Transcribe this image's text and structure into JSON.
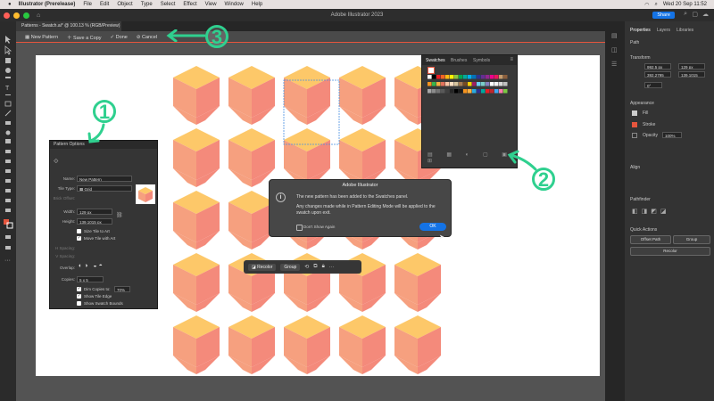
{
  "menubar": {
    "app": "Illustrator (Prerelease)",
    "items": [
      "File",
      "Edit",
      "Object",
      "Type",
      "Select",
      "Effect",
      "View",
      "Window",
      "Help"
    ],
    "datetime": "Wed 20 Sep  11:52"
  },
  "window": {
    "title": "Adobe Illustrator 2023",
    "share_label": "Share"
  },
  "document": {
    "tab_label": "Patterns - Swatch.ai* @ 100.13 % (RGB/Preview)"
  },
  "pattern_bar": {
    "new_pattern": "New Pattern",
    "save_copy": "Save a Copy",
    "done": "Done",
    "cancel": "Cancel"
  },
  "pattern_options": {
    "title": "Pattern Options",
    "name_label": "Name:",
    "name_value": "New Pattern",
    "tile_type_label": "Tile Type:",
    "tile_type_value": "Grid",
    "brick_offset_label": "Brick Offset:",
    "width_label": "Width:",
    "width_value": "129 px",
    "height_label": "Height:",
    "height_value": "139.1015 px",
    "size_tile_label": "Size Tile to Art",
    "move_tile_label": "Move Tile with Art",
    "h_spacing_label": "H Spacing:",
    "v_spacing_label": "V Spacing:",
    "overlap_label": "Overlap:",
    "copies_label": "Copies:",
    "copies_value": "5 x 5",
    "dim_copies_label": "Dim Copies to:",
    "dim_copies_value": "70%",
    "show_tile_edge_label": "Show Tile Edge",
    "show_swatch_bounds_label": "Show Swatch Bounds"
  },
  "swatches_panel": {
    "tabs": [
      "Swatches",
      "Brushes",
      "Symbols"
    ],
    "colors": [
      "#ffffff",
      "#000000",
      "#ed1c24",
      "#f26522",
      "#fdb913",
      "#fff200",
      "#8dc63f",
      "#00a651",
      "#00a99d",
      "#00aeef",
      "#0072bc",
      "#2e3192",
      "#662d91",
      "#92278f",
      "#ec008c",
      "#ed145b",
      "#c69c6d",
      "#8b5e3c",
      "#f7941d",
      "#39b54a",
      "#fbb040",
      "#e2725b",
      "#f9c5a6",
      "#ffe0c2",
      "#d7c49e",
      "#a67c52",
      "#754c24",
      "#ffd200",
      "#9e1f63",
      "#6dcff6",
      "#7accc8",
      "#8781bd",
      "#ffffff",
      "#f2f2f2",
      "#d9d9d9",
      "#bfbfbf",
      "#a6a6a6",
      "#8c8c8c",
      "#737373",
      "#595959",
      "#404040",
      "#262626",
      "#000000",
      "#1a1a1a",
      "#f7931e",
      "#fbb040",
      "#29abe2",
      "#2e3192",
      "#00a99d",
      "#ed1c24",
      "#c1272d",
      "#3fa9f5",
      "#ff7bac",
      "#7ac943"
    ]
  },
  "alert": {
    "title": "Adobe Illustrator",
    "message": "The new pattern has been added to the Swatches panel.",
    "detail": "Any changes made while in Pattern Editing Mode will be applied to the swatch upon exit.",
    "dont_show": "Don't Show Again",
    "ok": "OK"
  },
  "context_bar": {
    "recolor": "Recolor",
    "group": "Group"
  },
  "properties_panel": {
    "tabs": [
      "Properties",
      "Layers",
      "Libraries"
    ],
    "section_type": "Path",
    "transform_label": "Transform",
    "x_value": "992.5 px",
    "y_value": "392.2795",
    "w_value": "129 px",
    "h_value": "139.1015",
    "angle_value": "0°",
    "appearance_label": "Appearance",
    "fill_label": "Fill",
    "stroke_label": "Stroke",
    "opacity_label": "Opacity",
    "opacity_value": "100%",
    "align_label": "Align",
    "pathfinder_label": "Pathfinder",
    "quick_actions_label": "Quick Actions",
    "offset_path": "Offset Path",
    "ungroup": "Group",
    "recolor": "Recolor"
  },
  "annotations": {
    "one": "1",
    "two": "2",
    "three": "3"
  },
  "colors": {
    "cube_top": "#fdc869",
    "cube_left": "#f6a07f",
    "cube_right": "#f48a7b",
    "accent_green": "#2fd08f",
    "highlight_red": "#e6553d",
    "primary_blue": "#1473e6"
  }
}
